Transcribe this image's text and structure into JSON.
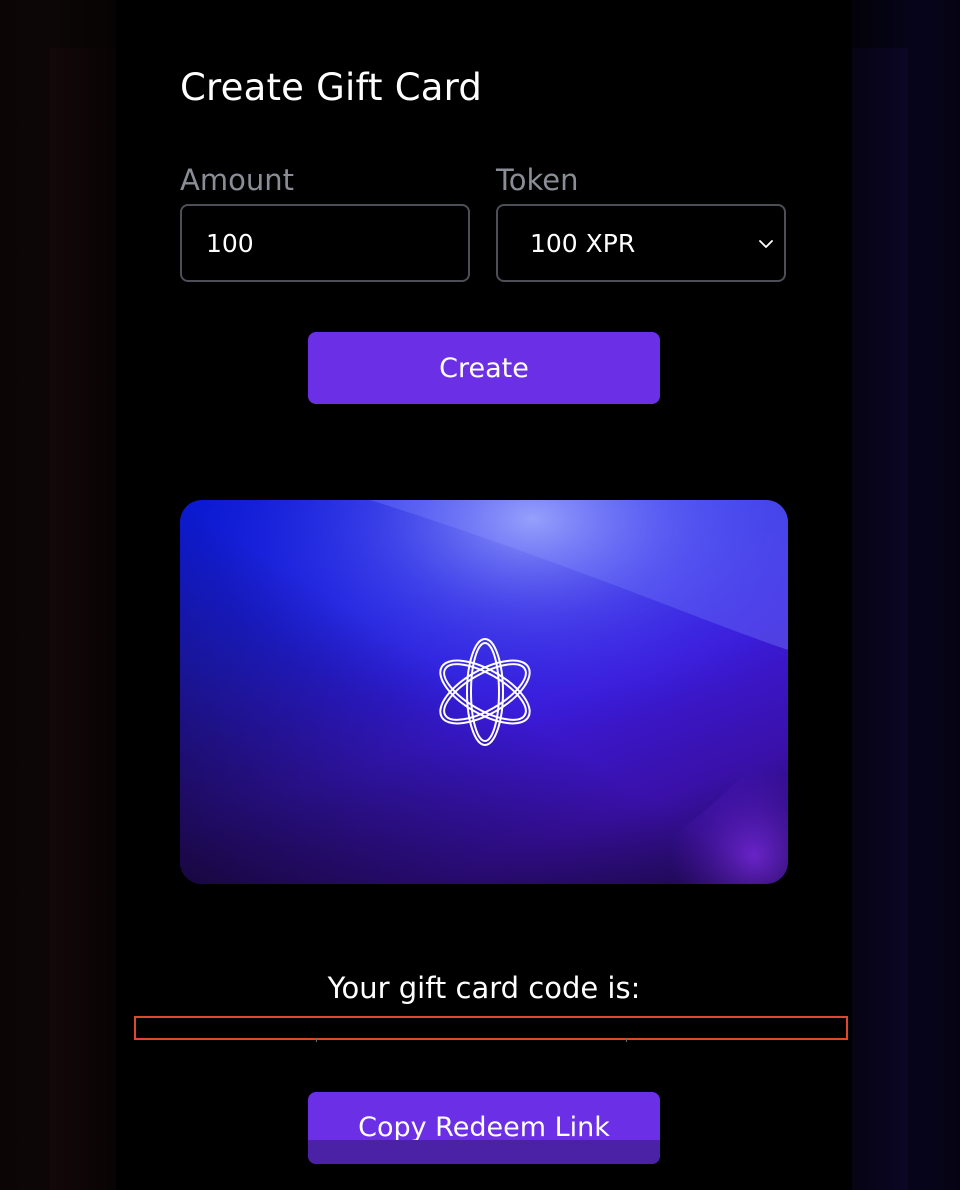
{
  "page": {
    "title": "Create Gift Card"
  },
  "form": {
    "amount_label": "Amount",
    "amount_value": "100",
    "token_label": "Token",
    "token_selected": "100 XPR",
    "create_label": "Create"
  },
  "gift_card": {
    "logo_icon": "atom-orbit-icon",
    "colors": {
      "card_deep_blue": "#0a1ad0",
      "card_violet": "#3a1ad8",
      "card_shadow": "#1a0840"
    }
  },
  "result": {
    "code_label": "Your gift card code is:",
    "code_value": "",
    "copy_label": "Copy Redeem Link"
  },
  "theme": {
    "accent": "#6b30e6",
    "background": "#000000",
    "muted_text": "#8a8c96",
    "border": "#4d4f57",
    "highlight_box": "#e0482e"
  }
}
